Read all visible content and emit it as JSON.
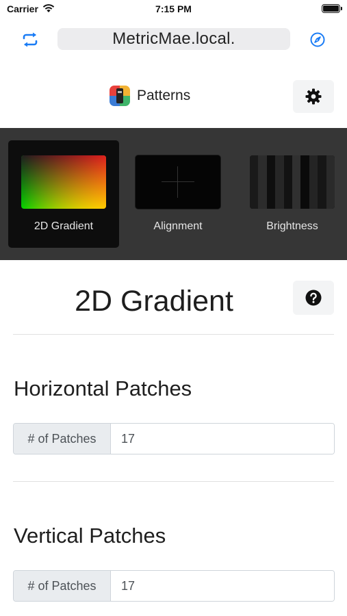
{
  "status_bar": {
    "carrier": "Carrier",
    "time": "7:15 PM",
    "battery_level": 1.0
  },
  "browser": {
    "url": "MetricMae.local.",
    "accent_color": "#1a7cf5"
  },
  "header": {
    "title": "Patterns"
  },
  "patterns": [
    {
      "label": "2D Gradient",
      "selected": true,
      "thumb_icon": "gradient-thumbnail"
    },
    {
      "label": "Alignment",
      "selected": false,
      "thumb_icon": "crosshair-thumbnail"
    },
    {
      "label": "Brightness",
      "selected": false,
      "thumb_icon": "brightness-bars-thumbnail"
    }
  ],
  "main": {
    "title": "2D Gradient",
    "sections": [
      {
        "heading": "Horizontal Patches",
        "prefix": "# of Patches",
        "value": "17"
      },
      {
        "heading": "Vertical Patches",
        "prefix": "# of Patches",
        "value": "17"
      }
    ]
  }
}
